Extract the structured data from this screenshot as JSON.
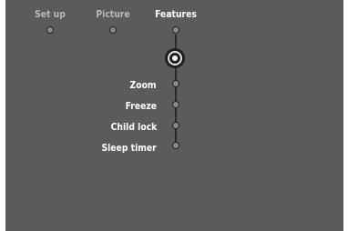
{
  "menu": {
    "tabs": [
      {
        "label": "Set up",
        "state": "inactive"
      },
      {
        "label": "Picture",
        "state": "inactive"
      },
      {
        "label": "Features",
        "state": "active"
      }
    ],
    "items": [
      {
        "label": "Zoom"
      },
      {
        "label": "Freeze"
      },
      {
        "label": "Child lock"
      },
      {
        "label": "Sleep timer"
      }
    ]
  },
  "colors": {
    "screen_background": "#5b5b5b",
    "active_text": "#ffffff",
    "inactive_text": "#b9b9b9"
  }
}
